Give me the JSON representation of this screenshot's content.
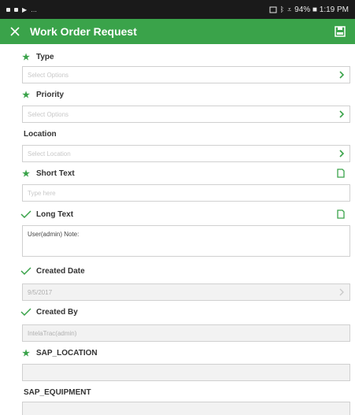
{
  "statusbar": {
    "right_text": "94% ■ 1:19 PM"
  },
  "appbar": {
    "title": "Work Order Request"
  },
  "fields": {
    "type": {
      "label": "Type",
      "placeholder": "Select Options"
    },
    "priority": {
      "label": "Priority",
      "placeholder": "Select Options"
    },
    "location": {
      "label": "Location",
      "placeholder": "Select Location"
    },
    "short_text": {
      "label": "Short Text",
      "placeholder": "Type here"
    },
    "long_text": {
      "label": "Long Text",
      "value": "User(admin) Note:"
    },
    "created_date": {
      "label": "Created Date",
      "value": "9/5/2017"
    },
    "created_by": {
      "label": "Created By",
      "value": "IntelaTrac(admin)"
    },
    "sap_location": {
      "label": "SAP_LOCATION",
      "value": ""
    },
    "sap_equipment": {
      "label": "SAP_EQUIPMENT",
      "value": ""
    }
  },
  "colors": {
    "accent": "#3aa34a",
    "statusbar": "#1a1a1a"
  },
  "icons": [
    "close-icon",
    "save-icon",
    "required-star-icon",
    "check-icon",
    "chevron-right-icon",
    "note-icon"
  ]
}
